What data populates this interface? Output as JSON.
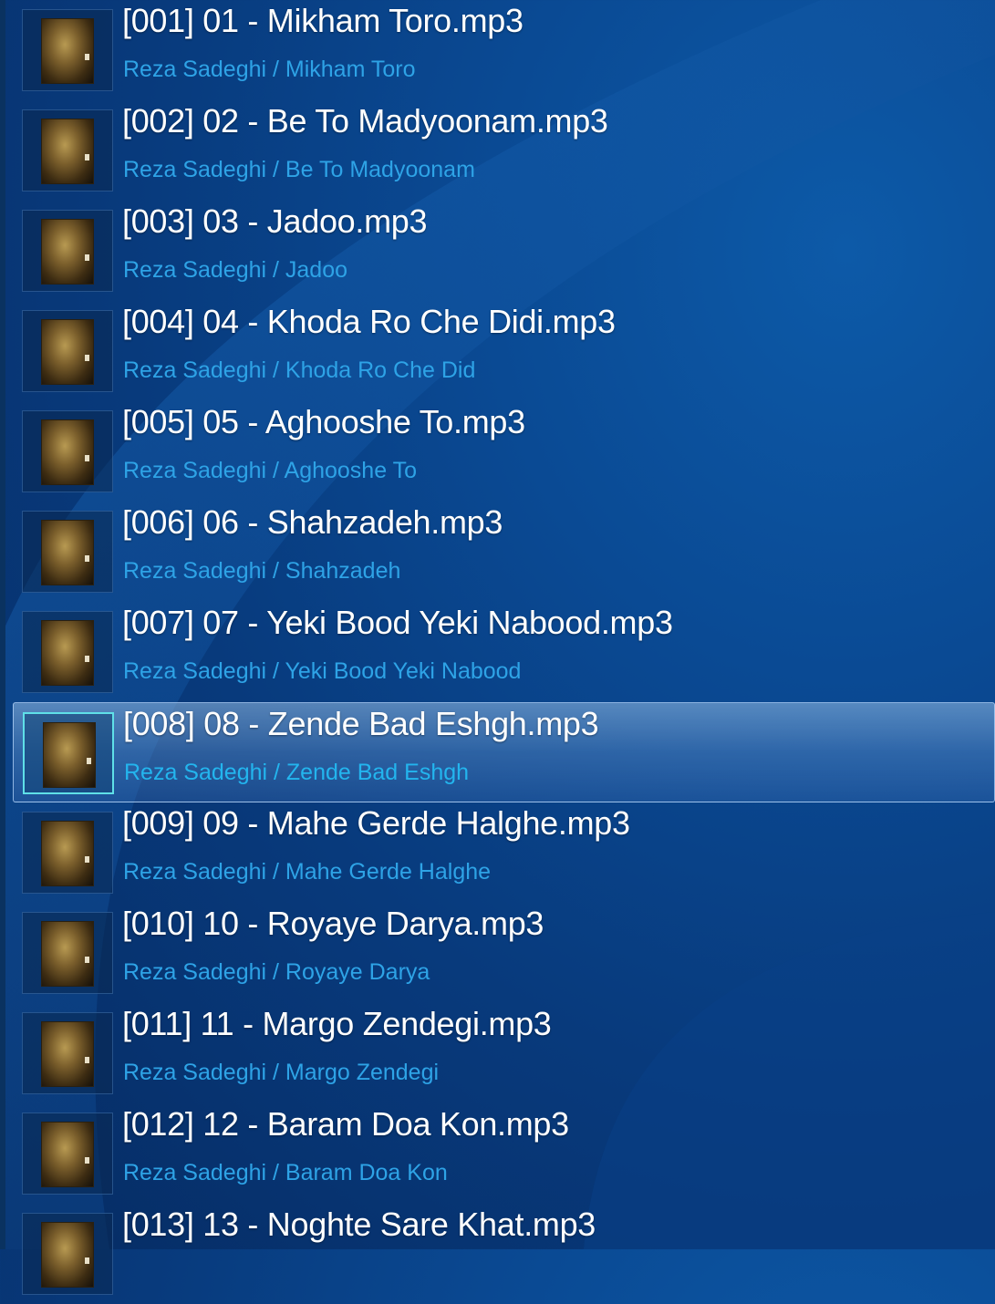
{
  "playlist": {
    "selected_index": 7,
    "items": [
      {
        "title": "[001] 01 - Mikham Toro.mp3",
        "subtitle": "Reza Sadeghi / Mikham Toro",
        "icon": "album-art-icon"
      },
      {
        "title": "[002] 02 - Be To Madyoonam.mp3",
        "subtitle": "Reza Sadeghi / Be To Madyoonam",
        "icon": "album-art-icon"
      },
      {
        "title": "[003] 03 - Jadoo.mp3",
        "subtitle": "Reza Sadeghi / Jadoo",
        "icon": "album-art-icon"
      },
      {
        "title": "[004] 04 - Khoda Ro Che Didi.mp3",
        "subtitle": "Reza Sadeghi / Khoda Ro Che Did",
        "icon": "album-art-icon"
      },
      {
        "title": "[005] 05 - Aghooshe To.mp3",
        "subtitle": "Reza Sadeghi / Aghooshe To",
        "icon": "album-art-icon"
      },
      {
        "title": "[006] 06 - Shahzadeh.mp3",
        "subtitle": "Reza Sadeghi / Shahzadeh",
        "icon": "album-art-icon"
      },
      {
        "title": "[007] 07 - Yeki Bood Yeki Nabood.mp3",
        "subtitle": "Reza Sadeghi / Yeki Bood Yeki Nabood",
        "icon": "album-art-icon"
      },
      {
        "title": "[008] 08 - Zende Bad Eshgh.mp3",
        "subtitle": "Reza Sadeghi / Zende Bad Eshgh",
        "icon": "album-art-icon"
      },
      {
        "title": "[009] 09 - Mahe Gerde Halghe.mp3",
        "subtitle": "Reza Sadeghi / Mahe Gerde Halghe",
        "icon": "album-art-icon"
      },
      {
        "title": "[010] 10 - Royaye Darya.mp3",
        "subtitle": "Reza Sadeghi / Royaye Darya",
        "icon": "album-art-icon"
      },
      {
        "title": "[011] 11 - Margo Zendegi.mp3",
        "subtitle": "Reza Sadeghi / Margo Zendegi",
        "icon": "album-art-icon"
      },
      {
        "title": "[012] 12 - Baram Doa Kon.mp3",
        "subtitle": "Reza Sadeghi / Baram Doa Kon",
        "icon": "album-art-icon"
      },
      {
        "title": "[013] 13 - Noghte Sare Khat.mp3",
        "subtitle": "",
        "icon": "album-art-icon"
      }
    ]
  },
  "colors": {
    "background": "#083a7c",
    "title_text": "#ffffff",
    "subtitle_text": "#2ea3e6",
    "selection_border": "#5fe0e8"
  }
}
